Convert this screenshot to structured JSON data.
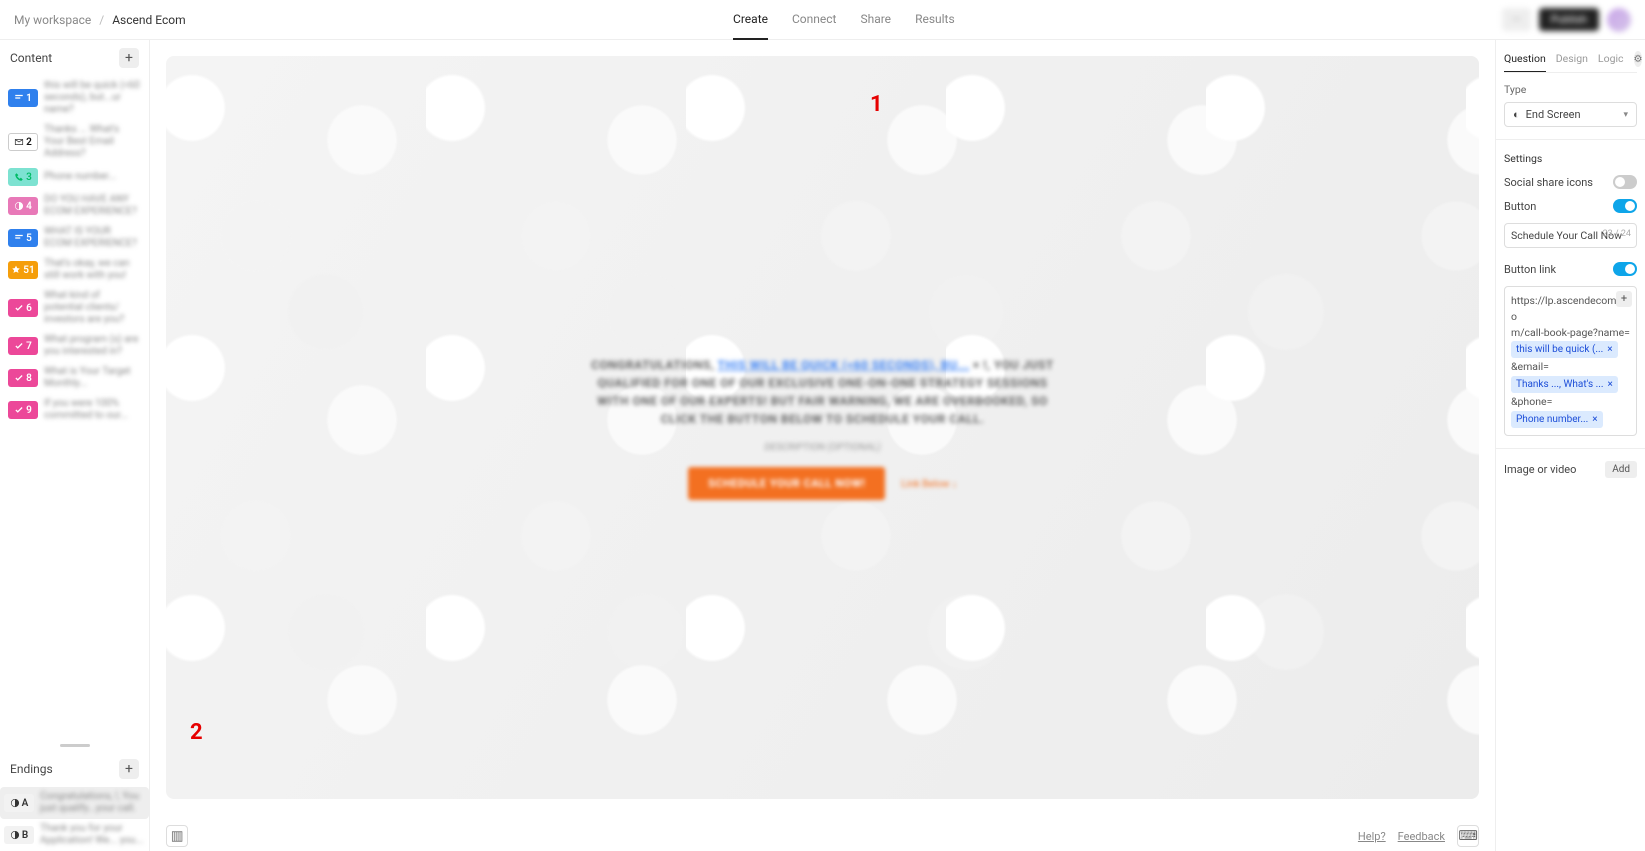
{
  "breadcrumb": {
    "workspace": "My workspace",
    "project": "Ascend Ecom"
  },
  "topnav": {
    "create": "Create",
    "connect": "Connect",
    "share": "Share",
    "results": "Results",
    "active": "create"
  },
  "topright": {
    "light": "···",
    "dark": "Publish"
  },
  "left": {
    "contentTitle": "Content",
    "endingsTitle": "Endings",
    "questions": [
      {
        "n": "1",
        "color": "#2f80ed",
        "icon": "text",
        "label": "this will be quick (<60 seconds), but...ur name?"
      },
      {
        "n": "2",
        "color": "#ffffff",
        "textColor": "#111",
        "border": "#ccc",
        "icon": "mail",
        "label": "Thanks ... What's Your Best Email Address?"
      },
      {
        "n": "3",
        "color": "#7de2d1",
        "textColor": "#0b6",
        "icon": "phone",
        "label": "Phone number..."
      },
      {
        "n": "4",
        "color": "#e879b8",
        "icon": "half",
        "label": "DO YOU HAVE ANY ECOM EXPERIENCE?"
      },
      {
        "n": "5",
        "color": "#2f80ed",
        "icon": "text",
        "label": "WHAT IS YOUR ECOM EXPERIENCE?"
      },
      {
        "n": "51",
        "color": "#f59e0b",
        "icon": "star",
        "label": "That's okay, we can still work with you!"
      },
      {
        "n": "6",
        "color": "#ec4899",
        "icon": "check",
        "label": "What kind of potential clients/ investors are you?"
      },
      {
        "n": "7",
        "color": "#ec4899",
        "icon": "check",
        "label": "What program (s) are you interested in?"
      },
      {
        "n": "8",
        "color": "#ec4899",
        "icon": "check",
        "label": "What is Your Target Monthly..."
      },
      {
        "n": "9",
        "color": "#ec4899",
        "icon": "check",
        "label": "If you were 100% committed to our..."
      }
    ],
    "endings": [
      {
        "n": "A",
        "label": "Congratulations, !, You just qualify...your call.",
        "selected": true
      },
      {
        "n": "B",
        "label": "Thank you for your Application! We... you..."
      }
    ]
  },
  "canvas": {
    "headline_pre": "CONGRATULATIONS,",
    "headline_link": "THIS WILL BE QUICK (<60 SECONDS), BU...",
    "headline_link_x": "×",
    "headline_post": "!, YOU JUST QUALIFIED FOR ONE OF OUR EXCLUSIVE ONE-ON-ONE STRATEGY SESSIONS WITH ONE OF OUR EXPERTS! BUT FAIR WARNING, WE ARE OVERBOOKED, SO CLICK THE BUTTON BELOW TO SCHEDULE YOUR CALL.",
    "description": "DESCRIPTION (OPTIONAL)",
    "button": "SCHEDULE YOUR CALL NOW!",
    "linkHint": "Link Below ↓"
  },
  "footer": {
    "help": "Help?",
    "feedback": "Feedback"
  },
  "right": {
    "tabs": {
      "question": "Question",
      "design": "Design",
      "logic": "Logic",
      "active": "question"
    },
    "typeLabel": "Type",
    "typeValue": "End Screen",
    "settingsLabel": "Settings",
    "socialShare": {
      "label": "Social share icons",
      "on": false
    },
    "button": {
      "label": "Button",
      "on": true,
      "value": "Schedule Your Call Now",
      "counter": "23 / 24"
    },
    "buttonLink": {
      "label": "Button link",
      "on": true,
      "url_pre": "https://lp.ascendecom.co",
      "url_line2": "m/call-book-page?name=",
      "chip1": "this will be quick (...",
      "param2": "&email=",
      "chip2": "Thanks ..., What's ...",
      "param3": "&phone=",
      "chip3": "Phone number..."
    },
    "imageVideo": {
      "label": "Image or video",
      "addBtn": "Add"
    }
  },
  "annotations": {
    "one": "1",
    "two": "2"
  }
}
